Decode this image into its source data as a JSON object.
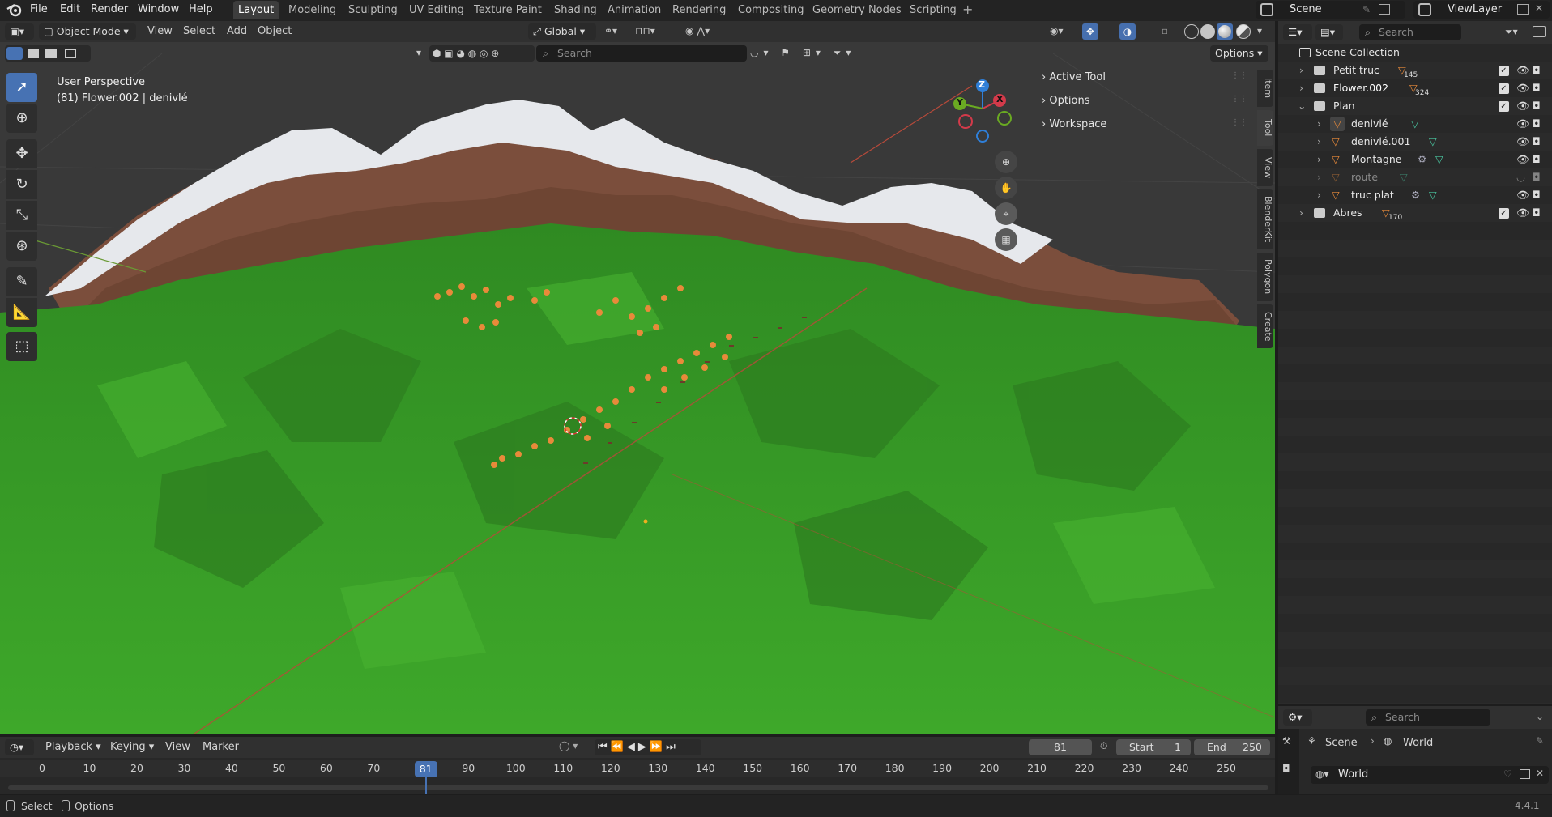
{
  "menus": [
    "File",
    "Edit",
    "Render",
    "Window",
    "Help"
  ],
  "workspaces": [
    "Layout",
    "Modeling",
    "Sculpting",
    "UV Editing",
    "Texture Paint",
    "Shading",
    "Animation",
    "Rendering",
    "Compositing",
    "Geometry Nodes",
    "Scripting"
  ],
  "scene": {
    "label": "Scene",
    "view_layer": "ViewLayer"
  },
  "viewport": {
    "mode": "Object Mode",
    "menu": [
      "View",
      "Select",
      "Add",
      "Object"
    ],
    "orientation": "Global",
    "search_placeholder": "Search",
    "options_label": "Options",
    "perspective": "User Perspective",
    "active_info": "(81) Flower.002 | denivlé",
    "gizmo_axes": {
      "z": "Z",
      "y": "Y",
      "x": "X"
    }
  },
  "npanel": {
    "sections": [
      "Active Tool",
      "Options",
      "Workspace"
    ],
    "tabs": [
      "Item",
      "Tool",
      "View",
      "BlenderKit",
      "Polygon",
      "Create"
    ]
  },
  "outliner": {
    "search_placeholder": "Search",
    "root": "Scene Collection",
    "rows": [
      {
        "name": "Petit truc",
        "badge": "145"
      },
      {
        "name": "Flower.002",
        "badge": "324"
      },
      {
        "name": "Plan",
        "badge": ""
      },
      {
        "name": "denivlé",
        "badge": ""
      },
      {
        "name": "denivlé.001",
        "badge": ""
      },
      {
        "name": "Montagne",
        "badge": ""
      },
      {
        "name": "route",
        "badge": ""
      },
      {
        "name": "truc plat",
        "badge": ""
      },
      {
        "name": "Abres",
        "badge": "170"
      }
    ]
  },
  "properties": {
    "search_placeholder": "Search",
    "breadcrumb_scene": "Scene",
    "breadcrumb_world": "World",
    "world_field": "World"
  },
  "timeline": {
    "menu": [
      "Playback",
      "Keying",
      "View",
      "Marker"
    ],
    "current_frame": "81",
    "start_label": "Start",
    "start": "1",
    "end_label": "End",
    "end": "250",
    "ticks": [
      "0",
      "10",
      "20",
      "30",
      "40",
      "50",
      "60",
      "70",
      "90",
      "100",
      "110",
      "120",
      "130",
      "140",
      "150",
      "160",
      "170",
      "180",
      "190",
      "200",
      "210",
      "220",
      "230",
      "240",
      "250"
    ],
    "playhead_value": 81,
    "frame_range": [
      0,
      250
    ]
  },
  "statusbar": {
    "select": "Select",
    "options": "Options",
    "version": "4.4.1"
  },
  "colors": {
    "accent": "#4772b3",
    "grass": "#3f9e2a",
    "rock": "#7a4e3a",
    "snow": "#e8eaee",
    "orange_trees": "#e88a3a"
  }
}
